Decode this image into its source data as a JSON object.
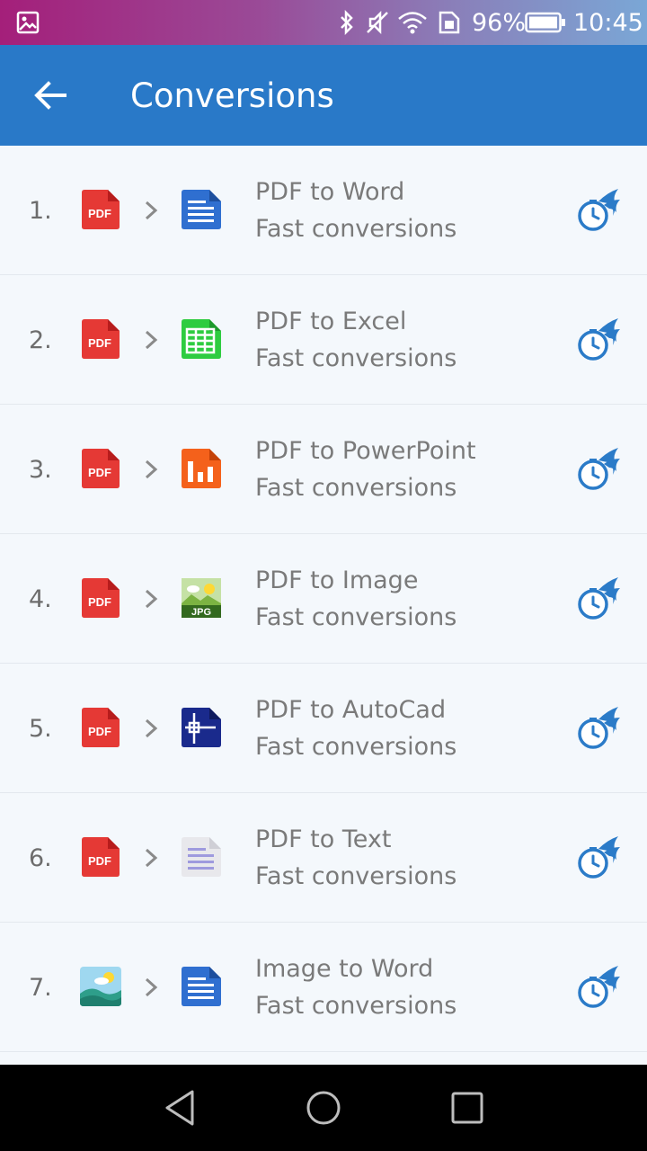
{
  "status_bar": {
    "battery": "96%",
    "time": "10:45"
  },
  "app_bar": {
    "title": "Conversions"
  },
  "items": [
    {
      "number": "1.",
      "title": "PDF to Word",
      "subtitle": "Fast conversions",
      "source_icon": "pdf-icon",
      "target_icon": "word-doc-icon"
    },
    {
      "number": "2.",
      "title": "PDF to Excel",
      "subtitle": "Fast conversions",
      "source_icon": "pdf-icon",
      "target_icon": "excel-sheet-icon"
    },
    {
      "number": "3.",
      "title": "PDF to PowerPoint",
      "subtitle": "Fast conversions",
      "source_icon": "pdf-icon",
      "target_icon": "powerpoint-icon"
    },
    {
      "number": "4.",
      "title": "PDF to Image",
      "subtitle": "Fast conversions",
      "source_icon": "pdf-icon",
      "target_icon": "jpg-image-icon"
    },
    {
      "number": "5.",
      "title": "PDF to AutoCad",
      "subtitle": "Fast conversions",
      "source_icon": "pdf-icon",
      "target_icon": "autocad-icon"
    },
    {
      "number": "6.",
      "title": "PDF to Text",
      "subtitle": "Fast conversions",
      "source_icon": "pdf-icon",
      "target_icon": "text-file-icon"
    },
    {
      "number": "7.",
      "title": "Image to Word",
      "subtitle": "Fast conversions",
      "source_icon": "image-icon",
      "target_icon": "word-doc-icon"
    }
  ],
  "icon_labels": {
    "pdf": "PDF",
    "jpg": "JPG"
  },
  "colors": {
    "app_bar": "#2979c8",
    "pdf_red": "#e53935",
    "word_blue": "#2f6fd0",
    "excel_green": "#2ecc40",
    "ppt_orange": "#f4611b",
    "autocad_navy": "#1a2a8c",
    "fast_icon_blue": "#2b7bc8"
  }
}
